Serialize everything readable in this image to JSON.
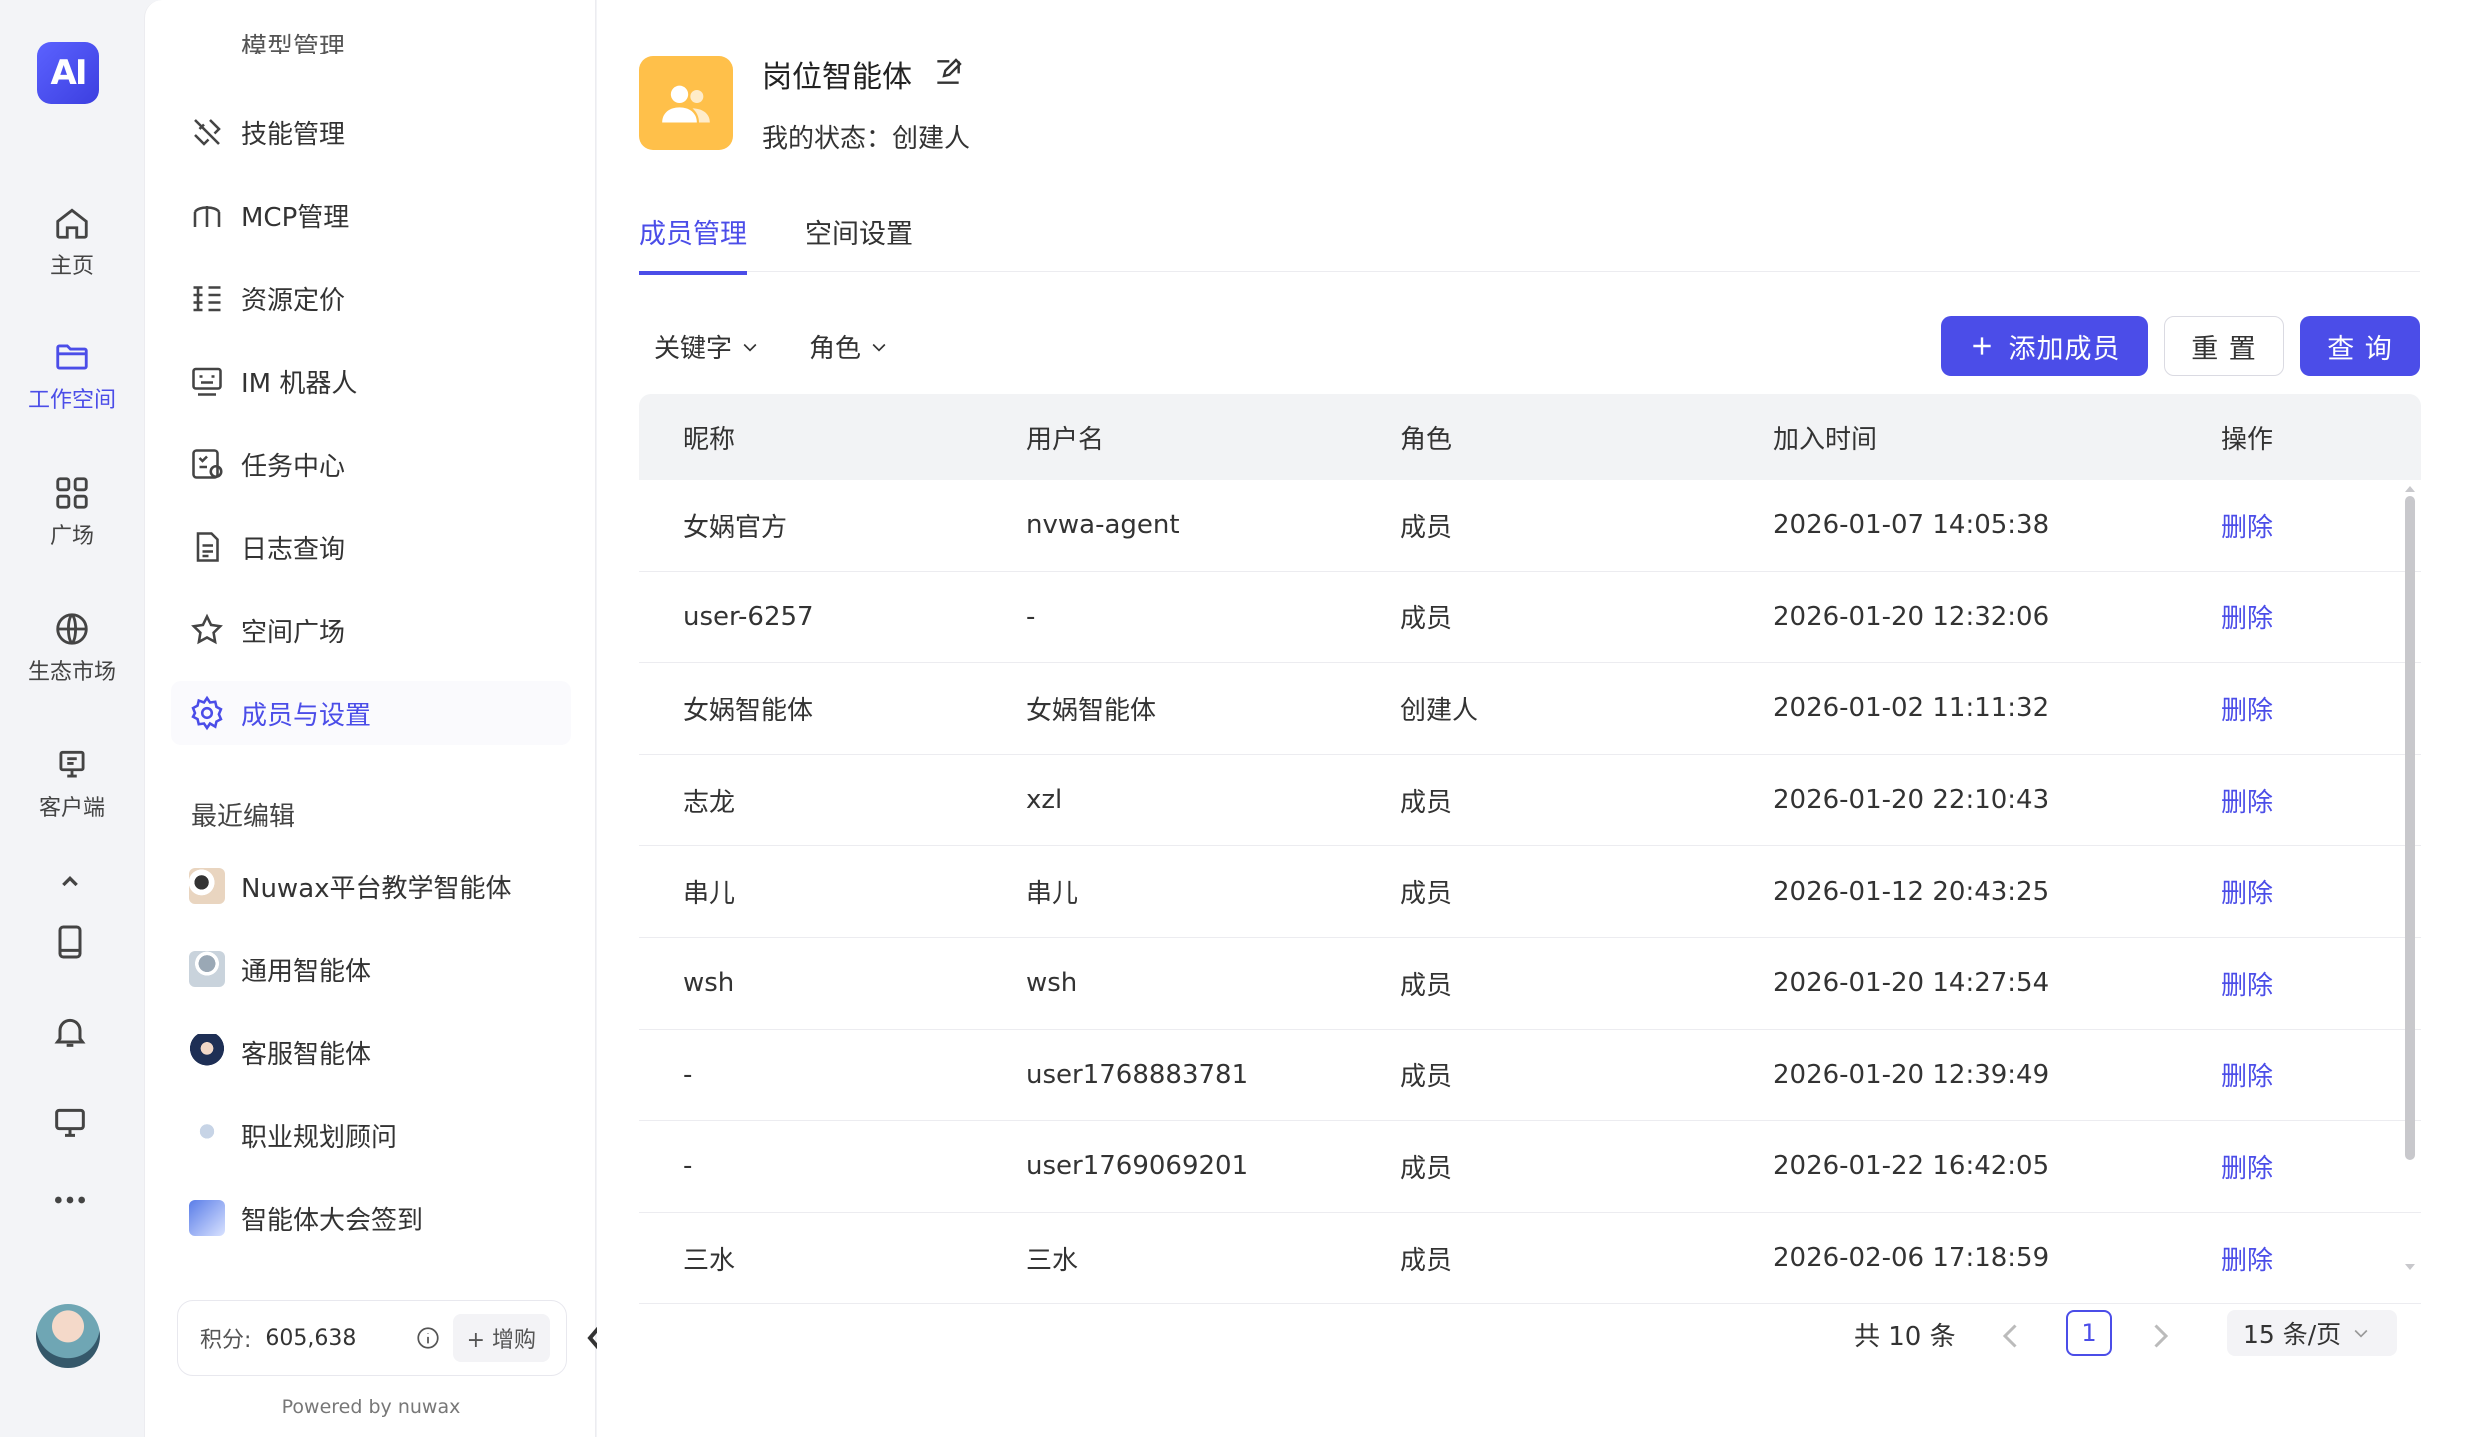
{
  "rail": {
    "logo": "AI",
    "items": [
      {
        "label": "主页",
        "icon": "home-icon"
      },
      {
        "label": "工作空间",
        "icon": "folder-icon"
      },
      {
        "label": "广场",
        "icon": "grid-icon"
      },
      {
        "label": "生态市场",
        "icon": "globe-icon"
      },
      {
        "label": "客户端",
        "icon": "monitor-icon"
      }
    ],
    "extra_icons": [
      "chevron-up-icon",
      "book-icon",
      "bell-icon",
      "desktop-icon",
      "more-icon"
    ]
  },
  "panel": {
    "partial_top_item": "模型管理",
    "menu": [
      {
        "label": "技能管理",
        "icon": "skills-icon"
      },
      {
        "label": "MCP管理",
        "icon": "mcp-icon"
      },
      {
        "label": "资源定价",
        "icon": "pricing-icon"
      },
      {
        "label": "IM 机器人",
        "icon": "robot-icon"
      },
      {
        "label": "任务中心",
        "icon": "task-icon"
      },
      {
        "label": "日志查询",
        "icon": "document-icon"
      },
      {
        "label": "空间广场",
        "icon": "star-icon"
      },
      {
        "label": "成员与设置",
        "icon": "gear-icon"
      }
    ],
    "recent_label": "最近编辑",
    "recent": [
      {
        "label": "Nuwax平台教学智能体"
      },
      {
        "label": "通用智能体"
      },
      {
        "label": "客服智能体"
      },
      {
        "label": "职业规划顾问"
      },
      {
        "label": "智能体大会签到"
      }
    ],
    "points_label": "积分:",
    "points_value": "605,638",
    "buy_label": "+ 增购",
    "powered_by": "Powered by nuwax"
  },
  "workspace": {
    "title": "岗位智能体",
    "status": "我的状态：创建人"
  },
  "tabs": [
    {
      "label": "成员管理",
      "active": true
    },
    {
      "label": "空间设置",
      "active": false
    }
  ],
  "filters": {
    "keyword": "关键字",
    "role": "角色"
  },
  "buttons": {
    "add": "添加成员",
    "reset": "重 置",
    "query": "查 询"
  },
  "table": {
    "headers": [
      "昵称",
      "用户名",
      "角色",
      "加入时间",
      "操作"
    ],
    "rows": [
      {
        "nickname": "女娲官方",
        "username": "nvwa-agent",
        "role": "成员",
        "joined": "2026-01-07 14:05:38",
        "action": "删除"
      },
      {
        "nickname": "user-6257",
        "username": "-",
        "role": "成员",
        "joined": "2026-01-20 12:32:06",
        "action": "删除"
      },
      {
        "nickname": "女娲智能体",
        "username": "女娲智能体",
        "role": "创建人",
        "joined": "2026-01-02 11:11:32",
        "action": "删除"
      },
      {
        "nickname": "志龙",
        "username": "xzl",
        "role": "成员",
        "joined": "2026-01-20 22:10:43",
        "action": "删除"
      },
      {
        "nickname": "串儿",
        "username": "串儿",
        "role": "成员",
        "joined": "2026-01-12 20:43:25",
        "action": "删除"
      },
      {
        "nickname": "wsh",
        "username": "wsh",
        "role": "成员",
        "joined": "2026-01-20 14:27:54",
        "action": "删除"
      },
      {
        "nickname": "-",
        "username": "user1768883781",
        "role": "成员",
        "joined": "2026-01-20 12:39:49",
        "action": "删除"
      },
      {
        "nickname": "-",
        "username": "user1769069201",
        "role": "成员",
        "joined": "2026-01-22 16:42:05",
        "action": "删除"
      },
      {
        "nickname": "三水",
        "username": "三水",
        "role": "成员",
        "joined": "2026-02-06 17:18:59",
        "action": "删除"
      }
    ]
  },
  "pagination": {
    "total": "共 10 条",
    "current": "1",
    "page_size": "15 条/页"
  },
  "colors": {
    "accent": "#4b4de8",
    "workspace_avatar": "#ffc04a"
  }
}
